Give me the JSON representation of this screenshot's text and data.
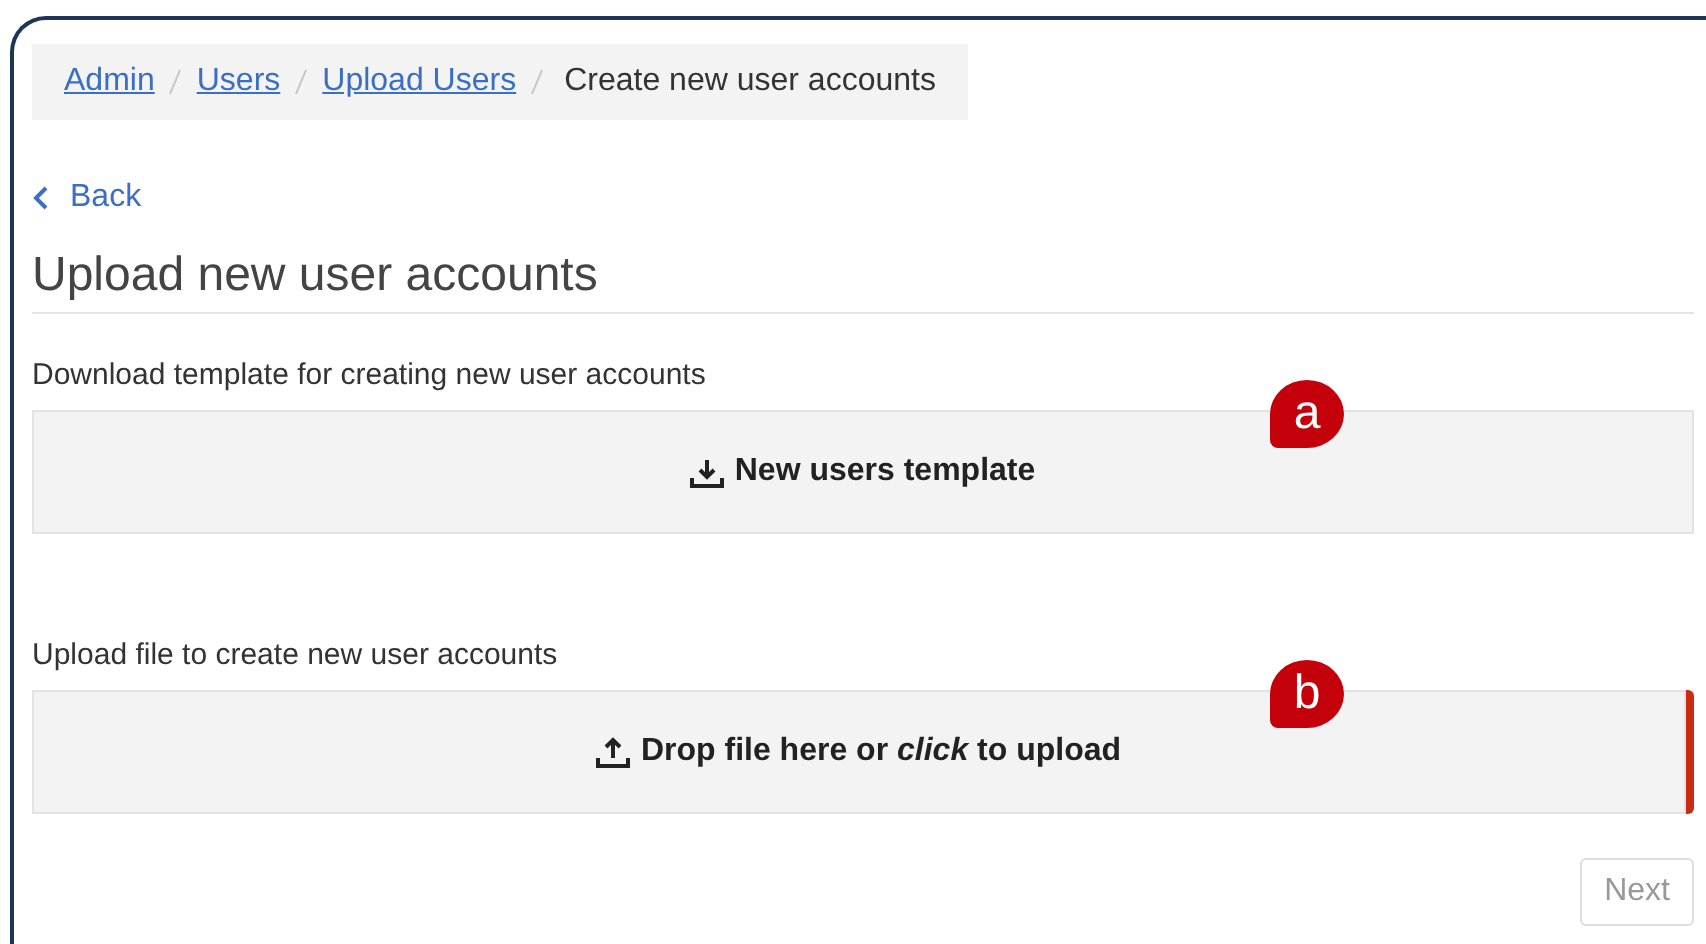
{
  "breadcrumb": [
    {
      "label": "Admin",
      "link": true
    },
    {
      "label": "Users",
      "link": true
    },
    {
      "label": "Upload Users",
      "link": true
    },
    {
      "label": "Create new user accounts",
      "link": false
    }
  ],
  "back": "Back",
  "heading": "Upload new user accounts",
  "sections": [
    {
      "kind": "download",
      "label": "Download template for creating new user accounts",
      "action": "New users template",
      "badge": "a",
      "highlighted": false
    },
    {
      "kind": "upload",
      "label": "Upload file to create new user accounts",
      "action": "Drop file here or *click* to upload",
      "badge": "b",
      "highlighted": true
    }
  ],
  "next": {
    "label": "Next",
    "disabled": true
  }
}
